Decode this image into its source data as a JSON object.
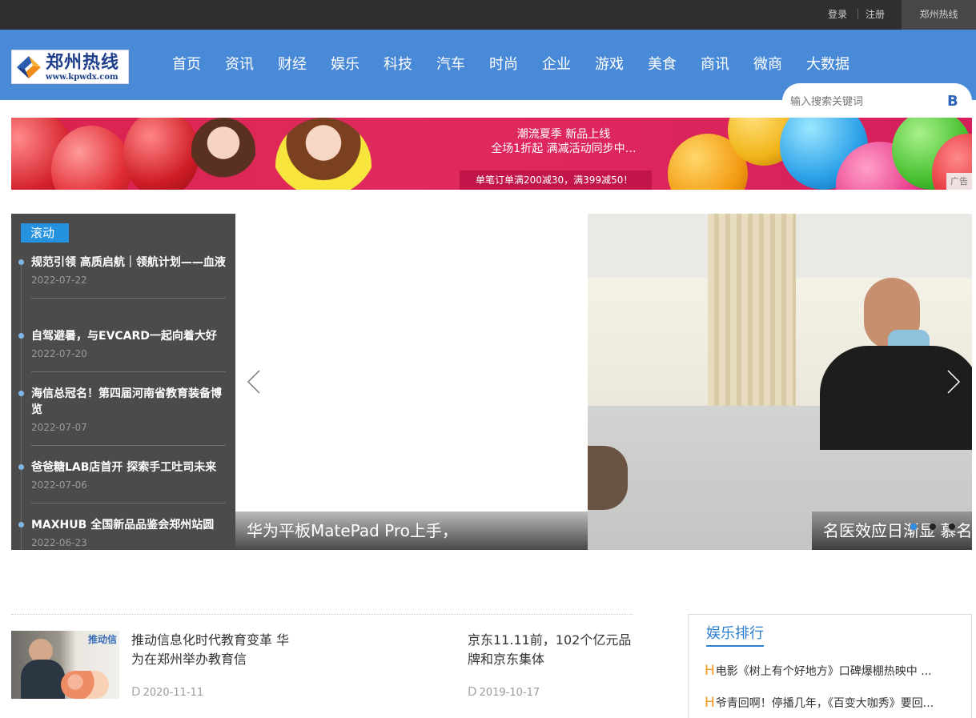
{
  "topbar": {
    "login": "登录",
    "register": "注册",
    "site": "郑州热线"
  },
  "header": {
    "logo_name": "郑州热线",
    "logo_url": "www.kpwdx.com",
    "nav": [
      "首页",
      "资讯",
      "财经",
      "娱乐",
      "科技",
      "汽车",
      "时尚",
      "企业",
      "游戏",
      "美食",
      "商讯",
      "微商",
      "大数据"
    ],
    "search_placeholder": "输入搜索关键词"
  },
  "banner": {
    "line1": "潮流夏季  新品上线",
    "line2": "全场1折起  满减活动同步中…",
    "promo": "单笔订单满200减30，满399减50！",
    "ad_tag": "广告"
  },
  "rolling": {
    "tag": "滚动",
    "items": [
      {
        "title": "规范引领 高质启航｜领航计划——血液",
        "date": "2022-07-22"
      },
      {
        "title": "自驾避暑，与EVCARD一起向着大好",
        "date": "2022-07-20"
      },
      {
        "title": "海信总冠名！第四届河南省教育装备博览",
        "date": "2022-07-07"
      },
      {
        "title": "爸爸糖LAB店首开 探索手工吐司未来",
        "date": "2022-07-06"
      },
      {
        "title": "MAXHUB 全国新品品鉴会郑州站圆",
        "date": "2022-06-23"
      }
    ]
  },
  "slider": {
    "caption_left": "华为平板MatePad Pro上手，",
    "caption_right": "名医效应日渐显 慕名"
  },
  "news": [
    {
      "title": "推动信息化时代教育变革 华为在郑州举办教育信",
      "date_mark": "D",
      "date": "2020-11-11",
      "thumb_text": "推动信"
    },
    {
      "title": "京东11.11前，102个亿元品牌和京东集体",
      "date_mark": "D",
      "date": "2019-10-17"
    }
  ],
  "ranking": {
    "title": "娱乐排行",
    "mark": "H",
    "items": [
      "电影《树上有个好地方》口碑爆棚热映中 ...",
      "爷青回啊！停播几年，《百变大咖秀》要回..."
    ]
  }
}
